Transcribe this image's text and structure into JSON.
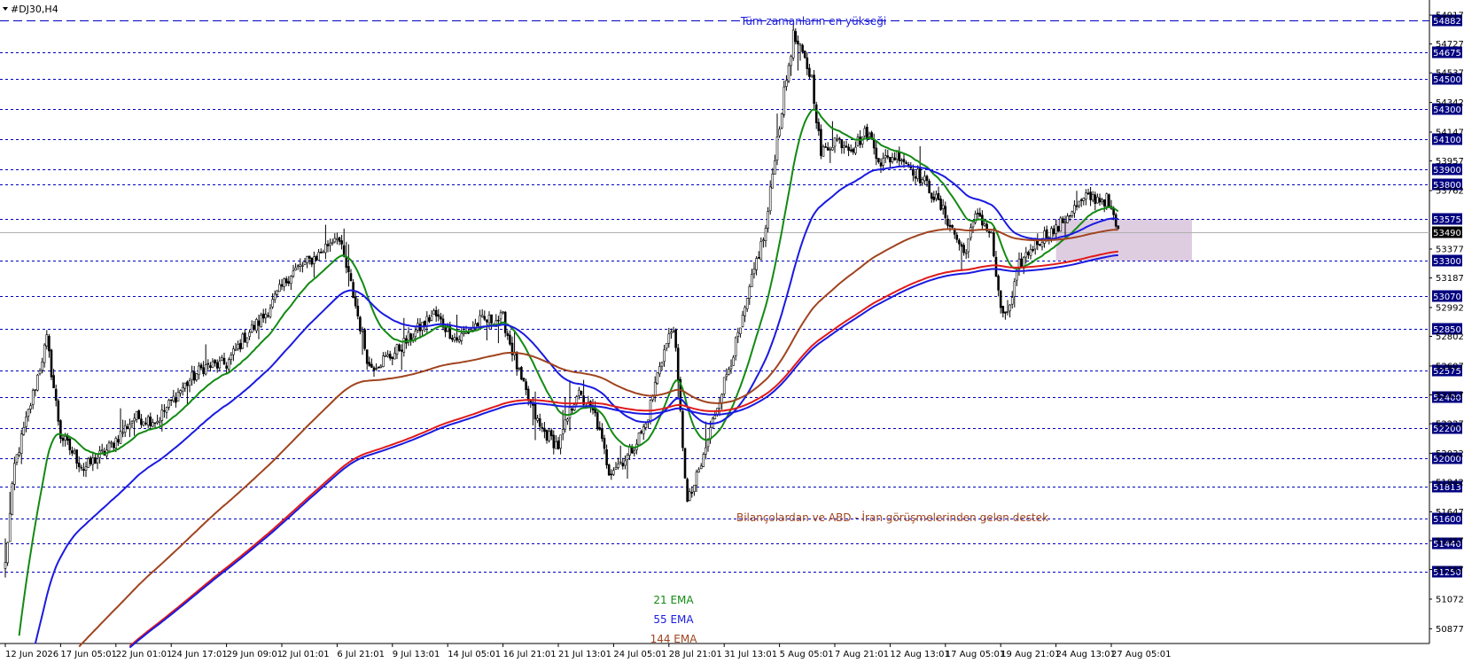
{
  "window": {
    "title": "#DJ30,H4",
    "menu_icon": "triangle-down-icon"
  },
  "chart_data": {
    "type": "candlestick",
    "symbol": "#DJ30",
    "timeframe": "H4",
    "ylim": [
      50780,
      54970
    ],
    "current_price": 53490,
    "annotations": {
      "ath": "Tüm zamanların en yükseği",
      "support": "Bilançolardan ve ABD - İran görüşmelerinden gelen destek",
      "ema21": "21 EMA",
      "ema55": "55 EMA",
      "ema144": "144 EMA"
    },
    "y_tick_labels": [
      "54917",
      "54727",
      "54537",
      "54342",
      "54147",
      "53957",
      "53762",
      "53377",
      "53187",
      "52992",
      "52802",
      "52607",
      "52417",
      "52227",
      "52032",
      "51842",
      "51647",
      "51457",
      "51267",
      "51072",
      "50877"
    ],
    "y_tick_values": [
      54917,
      54727,
      54537,
      54342,
      54147,
      53957,
      53762,
      53377,
      53187,
      52992,
      52802,
      52607,
      52417,
      52227,
      52032,
      51842,
      51647,
      51457,
      51267,
      51072,
      50877
    ],
    "levels": [
      {
        "value": 54882,
        "label": "54882",
        "style": "longdash"
      },
      {
        "value": 54675,
        "label": "54675",
        "style": "dot"
      },
      {
        "value": 54500,
        "label": "54500",
        "style": "dot"
      },
      {
        "value": 54300,
        "label": "54300",
        "style": "dot"
      },
      {
        "value": 54100,
        "label": "54100",
        "style": "dot"
      },
      {
        "value": 53900,
        "label": "53900",
        "style": "dot"
      },
      {
        "value": 53800,
        "label": "53800",
        "style": "dot"
      },
      {
        "value": 53575,
        "label": "53575",
        "style": "dot"
      },
      {
        "value": 53300,
        "label": "53300",
        "style": "dot"
      },
      {
        "value": 53070,
        "label": "53070",
        "style": "dot"
      },
      {
        "value": 52850,
        "label": "52850",
        "style": "dot"
      },
      {
        "value": 52575,
        "label": "52575",
        "style": "dot"
      },
      {
        "value": 52400,
        "label": "52400",
        "style": "dot"
      },
      {
        "value": 52200,
        "label": "52200",
        "style": "dot"
      },
      {
        "value": 52000,
        "label": "52000",
        "style": "dot"
      },
      {
        "value": 51813,
        "label": "51813",
        "style": "dot"
      },
      {
        "value": 51600,
        "label": "51600",
        "style": "dot"
      },
      {
        "value": 51440,
        "label": "51440",
        "style": "dot"
      },
      {
        "value": 51250,
        "label": "51250",
        "style": "dot"
      }
    ],
    "x_tick_labels": [
      "12 Jun 2026",
      "17 Jun 05:01",
      "22 Jun 01:01",
      "24 Jun 17:01",
      "29 Jun 09:01",
      "2 Jul 01:01",
      "6 Jul 21:01",
      "9 Jul 13:01",
      "14 Jul 05:01",
      "16 Jul 21:01",
      "21 Jul 13:01",
      "24 Jul 05:01",
      "28 Jul 21:01",
      "31 Jul 13:01",
      "5 Aug 05:01",
      "7 Aug 21:01",
      "12 Aug 13:01",
      "17 Aug 05:01",
      "19 Aug 21:01",
      "24 Aug 13:01",
      "27 Aug 05:01"
    ],
    "x_tick_index": [
      0,
      24,
      48,
      72,
      96,
      120,
      144,
      168,
      192,
      216,
      240,
      264,
      288,
      312,
      336,
      360,
      384,
      408,
      432,
      456,
      480
    ],
    "bar_count": 484,
    "zone": {
      "from_index": 456,
      "to_index": 515,
      "high": 53575,
      "low": 53300,
      "color": "#d8c4dc"
    },
    "price_path": [
      [
        0,
        51300
      ],
      [
        4,
        51950
      ],
      [
        10,
        52300
      ],
      [
        18,
        52780
      ],
      [
        24,
        52150
      ],
      [
        34,
        51930
      ],
      [
        44,
        52050
      ],
      [
        56,
        52270
      ],
      [
        66,
        52250
      ],
      [
        76,
        52450
      ],
      [
        86,
        52600
      ],
      [
        96,
        52620
      ],
      [
        104,
        52800
      ],
      [
        112,
        52930
      ],
      [
        124,
        53220
      ],
      [
        136,
        53340
      ],
      [
        144,
        53480
      ],
      [
        150,
        53140
      ],
      [
        158,
        52600
      ],
      [
        168,
        52680
      ],
      [
        176,
        52800
      ],
      [
        186,
        52950
      ],
      [
        196,
        52780
      ],
      [
        206,
        52900
      ],
      [
        216,
        52920
      ],
      [
        224,
        52500
      ],
      [
        232,
        52200
      ],
      [
        240,
        52080
      ],
      [
        248,
        52430
      ],
      [
        256,
        52280
      ],
      [
        262,
        51920
      ],
      [
        270,
        52010
      ],
      [
        278,
        52220
      ],
      [
        284,
        52620
      ],
      [
        290,
        52880
      ],
      [
        296,
        51700
      ],
      [
        302,
        51950
      ],
      [
        308,
        52300
      ],
      [
        314,
        52600
      ],
      [
        320,
        52900
      ],
      [
        326,
        53300
      ],
      [
        330,
        53500
      ],
      [
        334,
        54000
      ],
      [
        338,
        54400
      ],
      [
        342,
        54780
      ],
      [
        346,
        54650
      ],
      [
        350,
        54500
      ],
      [
        354,
        54000
      ],
      [
        360,
        54100
      ],
      [
        368,
        54050
      ],
      [
        374,
        54150
      ],
      [
        380,
        53950
      ],
      [
        388,
        54000
      ],
      [
        394,
        53900
      ],
      [
        400,
        53800
      ],
      [
        408,
        53600
      ],
      [
        416,
        53350
      ],
      [
        422,
        53620
      ],
      [
        428,
        53460
      ],
      [
        432,
        52950
      ],
      [
        436,
        52980
      ],
      [
        440,
        53270
      ],
      [
        446,
        53400
      ],
      [
        452,
        53480
      ],
      [
        456,
        53500
      ],
      [
        462,
        53620
      ],
      [
        470,
        53720
      ],
      [
        478,
        53700
      ],
      [
        483,
        53490
      ]
    ],
    "series": [
      {
        "name": "21 EMA",
        "period": 21,
        "color": "#138a13"
      },
      {
        "name": "55 EMA",
        "period": 55,
        "color": "#1a1ae0"
      },
      {
        "name": "144 EMA",
        "period": 144,
        "color": "#a0441f"
      },
      {
        "name": "",
        "period": 233,
        "color": "#e01a1a",
        "offset": 24
      },
      {
        "name": "",
        "period": 233,
        "color": "#1a1ae0",
        "offset": 0
      }
    ],
    "grid": false,
    "colors": {
      "candle": "#000000",
      "level": "#0000c0",
      "label_box": "#000080",
      "ath_text": "#1a1ae0",
      "support_text": "#a0441f"
    }
  }
}
